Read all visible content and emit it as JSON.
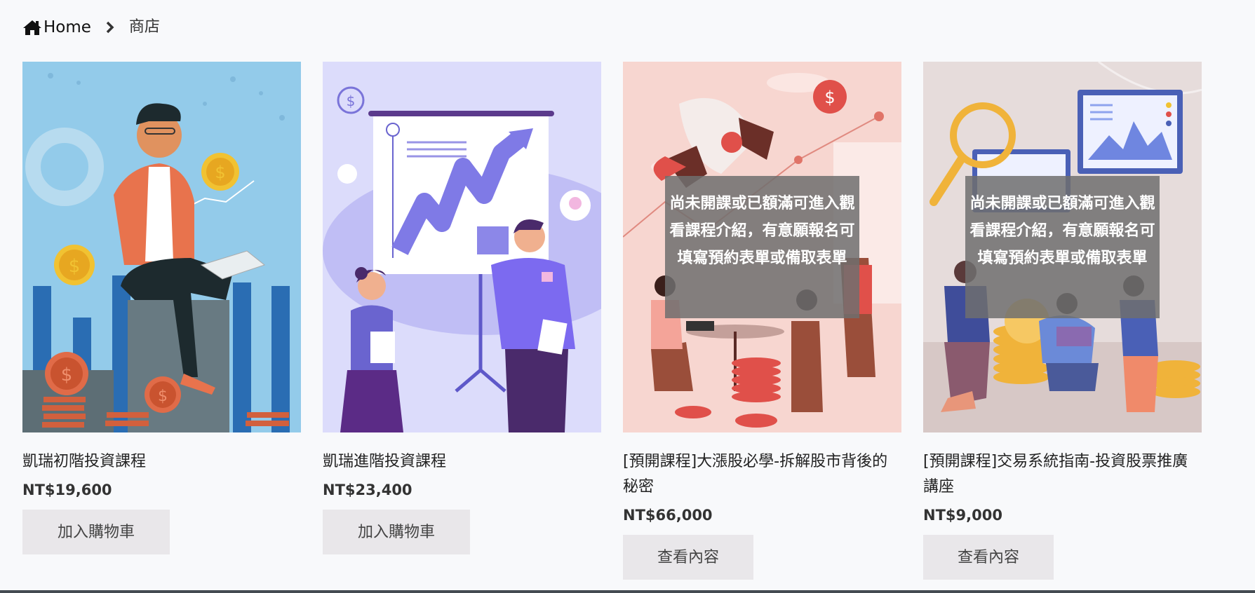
{
  "breadcrumb": {
    "home_label": "Home",
    "current": "商店"
  },
  "products": [
    {
      "title": "凱瑞初階投資課程",
      "price": "NT$19,600",
      "button": "加入購物車"
    },
    {
      "title": "凱瑞進階投資課程",
      "price": "NT$23,400",
      "button": "加入購物車"
    },
    {
      "title": "[預開課程]大漲股必學-拆解股市背後的秘密",
      "price": "NT$66,000",
      "button": "查看內容",
      "overlay": "尚未開課或已額滿可進入觀看課程介紹，有意願報名可填寫預約表單或備取表單"
    },
    {
      "title": "[預開課程]交易系統指南-投資股票推廣講座",
      "price": "NT$9,000",
      "button": "查看內容",
      "overlay": "尚未開課或已額滿可進入觀看課程介紹，有意願報名可填寫預約表單或備取表單"
    }
  ],
  "icons": {
    "home": "home-icon",
    "separator": "chevron-right-icon",
    "coin": "dollar-coin-icon"
  },
  "colors": {
    "page_bg": "#f8f9fb",
    "button_bg": "#e9e7ea",
    "overlay_bg": "#6e6e6e"
  }
}
